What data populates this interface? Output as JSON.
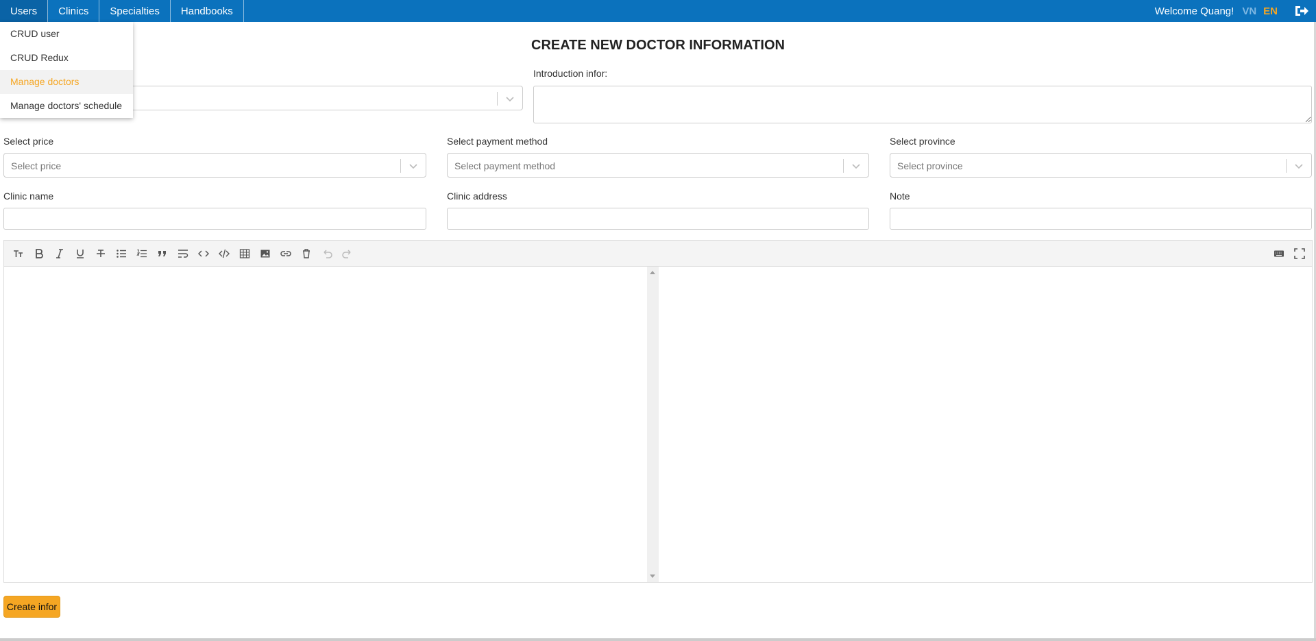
{
  "nav": {
    "items": [
      {
        "label": "Users"
      },
      {
        "label": "Clinics"
      },
      {
        "label": "Specialties"
      },
      {
        "label": "Handbooks"
      }
    ]
  },
  "header": {
    "welcome": "Welcome Quang!",
    "lang_vn": "VN",
    "lang_en": "EN",
    "active_lang": "EN",
    "logout_icon": "sign-out-icon"
  },
  "dropdown": {
    "items": [
      {
        "label": "CRUD user"
      },
      {
        "label": "CRUD Redux"
      },
      {
        "label": "Manage doctors",
        "active": true
      },
      {
        "label": "Manage doctors' schedule"
      }
    ]
  },
  "form": {
    "title": "CREATE NEW DOCTOR INFORMATION",
    "intro_label": "Introduction infor:",
    "price_label": "Select price",
    "price_placeholder": "Select price",
    "payment_label": "Select payment method",
    "payment_placeholder": "Select payment method",
    "province_label": "Select province",
    "province_placeholder": "Select province",
    "clinic_name_label": "Clinic name",
    "clinic_address_label": "Clinic address",
    "note_label": "Note",
    "submit_label": "Create infor"
  },
  "editor": {
    "toolbar_icons": [
      "font-size-icon",
      "bold-icon",
      "italic-icon",
      "underline-icon",
      "strikethrough-icon",
      "bullet-list-icon",
      "ordered-list-icon",
      "blockquote-icon",
      "text-wrap-icon",
      "code-icon",
      "code-block-icon",
      "table-icon",
      "image-icon",
      "link-icon",
      "clear-icon",
      "undo-icon",
      "redo-icon"
    ],
    "right_icons": [
      "keyboard-icon",
      "fullscreen-icon"
    ]
  },
  "colors": {
    "topbar": "#0b72bd",
    "accent": "#f5a623"
  }
}
